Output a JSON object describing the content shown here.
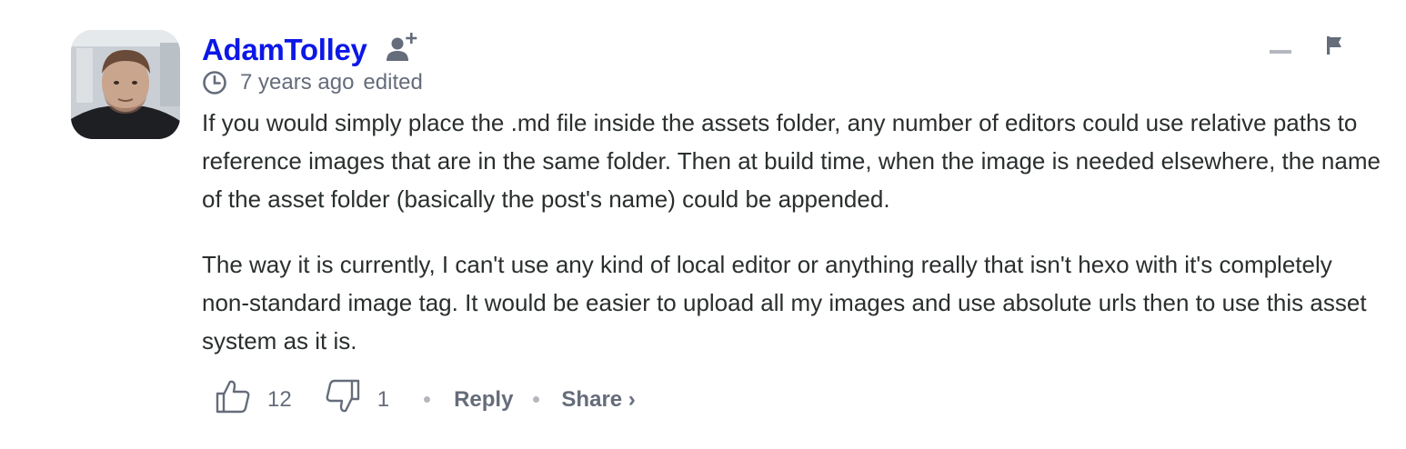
{
  "comment": {
    "author": "AdamTolley",
    "timestamp": "7 years ago",
    "edited": "edited",
    "paragraphs": [
      "If you would simply place the .md file inside the assets folder, any number of editors could use relative paths to reference images that are in the same folder. Then at build time, when the image is needed elsewhere, the name of the asset folder (basically the post's name) could be appended.",
      "The way it is currently, I can't use any kind of local editor or anything really that isn't hexo with it's completely non-standard image tag. It would be easier to upload all my images and use absolute urls then to use this asset system as it is."
    ],
    "upvotes": "12",
    "downvotes": "1",
    "reply_label": "Reply",
    "share_label": "Share ›"
  },
  "colors": {
    "author": "#0c18e6",
    "meta": "#656c7a",
    "text": "#2a2e2e",
    "muted": "#b4b8be"
  },
  "icons": {
    "follow": "add-user-icon",
    "clock": "clock-icon",
    "upvote": "thumbs-up-icon",
    "downvote": "thumbs-down-icon",
    "collapse": "minus-icon",
    "flag": "flag-icon"
  }
}
